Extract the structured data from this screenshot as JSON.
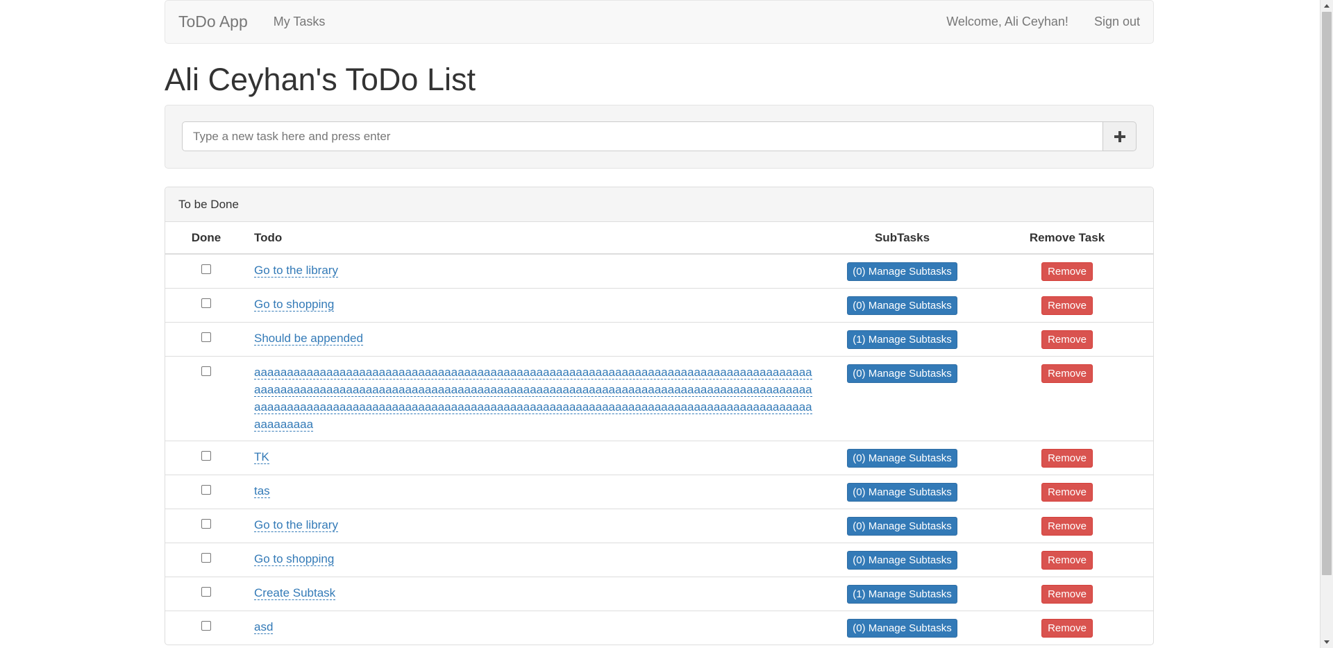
{
  "navbar": {
    "brand": "ToDo App",
    "my_tasks": "My Tasks",
    "welcome": "Welcome, Ali Ceyhan!",
    "sign_out": "Sign out"
  },
  "page_title": "Ali Ceyhan's ToDo List",
  "new_task": {
    "placeholder": "Type a new task here and press enter",
    "value": "",
    "add_icon": "plus-icon"
  },
  "panel": {
    "heading": "To be Done",
    "columns": {
      "done": "Done",
      "todo": "Todo",
      "subtasks": "SubTasks",
      "remove": "Remove Task"
    },
    "rows": [
      {
        "done": false,
        "todo": "Go to the library",
        "subtasks": "(0) Manage Subtasks",
        "remove": "Remove"
      },
      {
        "done": false,
        "todo": "Go to shopping",
        "subtasks": "(0) Manage Subtasks",
        "remove": "Remove"
      },
      {
        "done": false,
        "todo": "Should be appended",
        "subtasks": "(1) Manage Subtasks",
        "remove": "Remove"
      },
      {
        "done": false,
        "todo": "aaaaaaaaaaaaaaaaaaaaaaaaaaaaaaaaaaaaaaaaaaaaaaaaaaaaaaaaaaaaaaaaaaaaaaaaaaaaaaaaaaaaaaaaaaaaaaaaaaaaaaaaaaaaaaaaaaaaaaaaaaaaaaaaaaaaaaaaaaaaaaaaaaaaaaaaaaaaaaaaaaaaaaaaaaaaaaaaaaaaaaaaaaaaaaaaaaaaaaaaaaaaaaaaaaaaaaaaaaaaaaaaaaaaaaaaaaaaaaaaaaaaaaaaaaaaaaaaaaaaaaaa",
        "subtasks": "(0) Manage Subtasks",
        "remove": "Remove"
      },
      {
        "done": false,
        "todo": "TK",
        "subtasks": "(0) Manage Subtasks",
        "remove": "Remove"
      },
      {
        "done": false,
        "todo": "tas",
        "subtasks": "(0) Manage Subtasks",
        "remove": "Remove"
      },
      {
        "done": false,
        "todo": "Go to the library",
        "subtasks": "(0) Manage Subtasks",
        "remove": "Remove"
      },
      {
        "done": false,
        "todo": "Go to shopping",
        "subtasks": "(0) Manage Subtasks",
        "remove": "Remove"
      },
      {
        "done": false,
        "todo": "Create Subtask",
        "subtasks": "(1) Manage Subtasks",
        "remove": "Remove"
      },
      {
        "done": false,
        "todo": "asd",
        "subtasks": "(0) Manage Subtasks",
        "remove": "Remove"
      }
    ]
  },
  "colors": {
    "primary": "#337ab7",
    "danger": "#d9534f",
    "navbar_bg": "#f8f8f8",
    "well_bg": "#f5f5f5"
  }
}
